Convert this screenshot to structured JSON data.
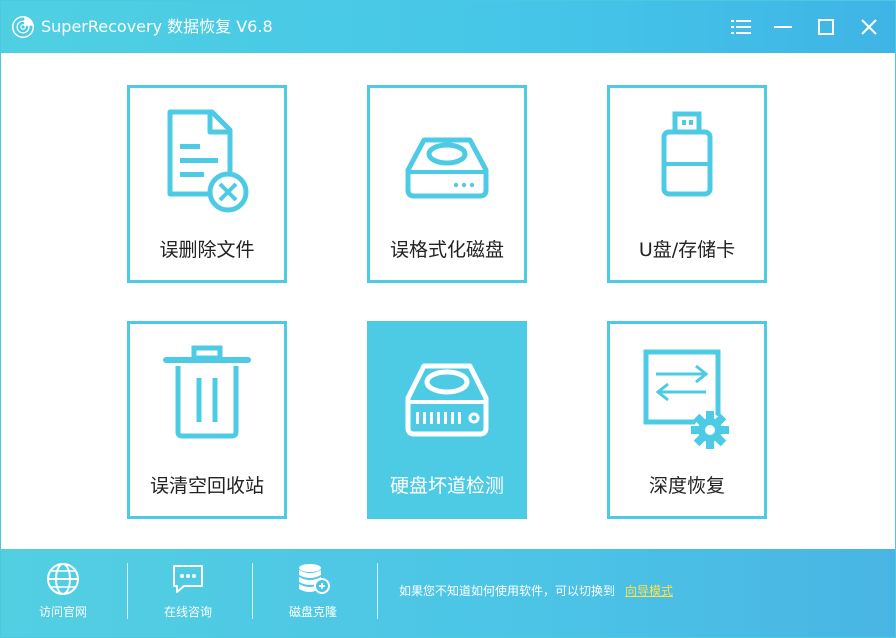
{
  "app": {
    "title": "SuperRecovery 数据恢复 V6.8",
    "logo_icon": "recovery-logo-icon"
  },
  "window_controls": {
    "menu_icon": "hamburger-menu-icon",
    "minimize_icon": "minimize-icon",
    "maximize_icon": "maximize-icon",
    "close_icon": "close-icon"
  },
  "tiles": [
    {
      "label": "误删除文件",
      "icon": "deleted-file-icon",
      "active": false
    },
    {
      "label": "误格式化磁盘",
      "icon": "hard-disk-icon",
      "active": false
    },
    {
      "label": "U盘/存储卡",
      "icon": "usb-drive-icon",
      "active": false
    },
    {
      "label": "误清空回收站",
      "icon": "trash-bin-icon",
      "active": false
    },
    {
      "label": "硬盘坏道检测",
      "icon": "disk-scan-icon",
      "active": true
    },
    {
      "label": "深度恢复",
      "icon": "deep-recovery-icon",
      "active": false
    }
  ],
  "footer": {
    "items": [
      {
        "label": "访问官网",
        "icon": "globe-icon"
      },
      {
        "label": "在线咨询",
        "icon": "chat-bubble-icon"
      },
      {
        "label": "磁盘克隆",
        "icon": "database-clone-icon"
      }
    ],
    "hint_text": "如果您不知道如何使用软件，可以切换到",
    "hint_link": "向导模式"
  },
  "colors": {
    "accent": "#4dcbe4",
    "link": "#ffe14d",
    "text": "#222222"
  }
}
